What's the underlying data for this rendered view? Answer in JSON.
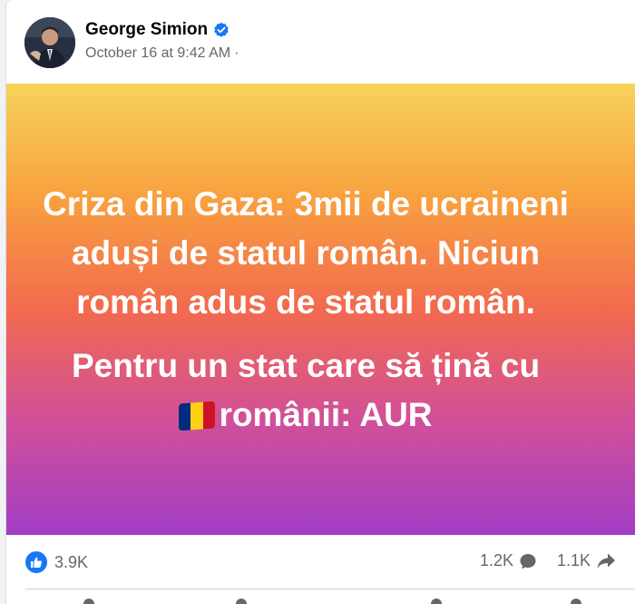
{
  "post": {
    "author": "George Simion",
    "timestamp": "October 16 at 9:42 AM",
    "separator": "·",
    "body_lines": [
      "Criza din Gaza: 3mii de ucraineni aduși de statul român. Niciun român adus de statul român.",
      "Pentru un stat care să țină cu"
    ],
    "body_flag_text": "românii: AUR",
    "icons": {
      "verified": "verified-badge-icon",
      "audience": "globe-icon",
      "flag": "romania-flag-emoji",
      "like": "like-icon",
      "comment": "comment-icon",
      "share": "share-icon"
    },
    "colors": {
      "like_blue": "#1877f2",
      "flag_blue": "#002b7f",
      "flag_yellow": "#fcd116",
      "flag_red": "#ce1126"
    }
  },
  "footer": {
    "reactions_count": "3.9K",
    "comments_count": "1.2K",
    "shares_count": "1.1K"
  }
}
